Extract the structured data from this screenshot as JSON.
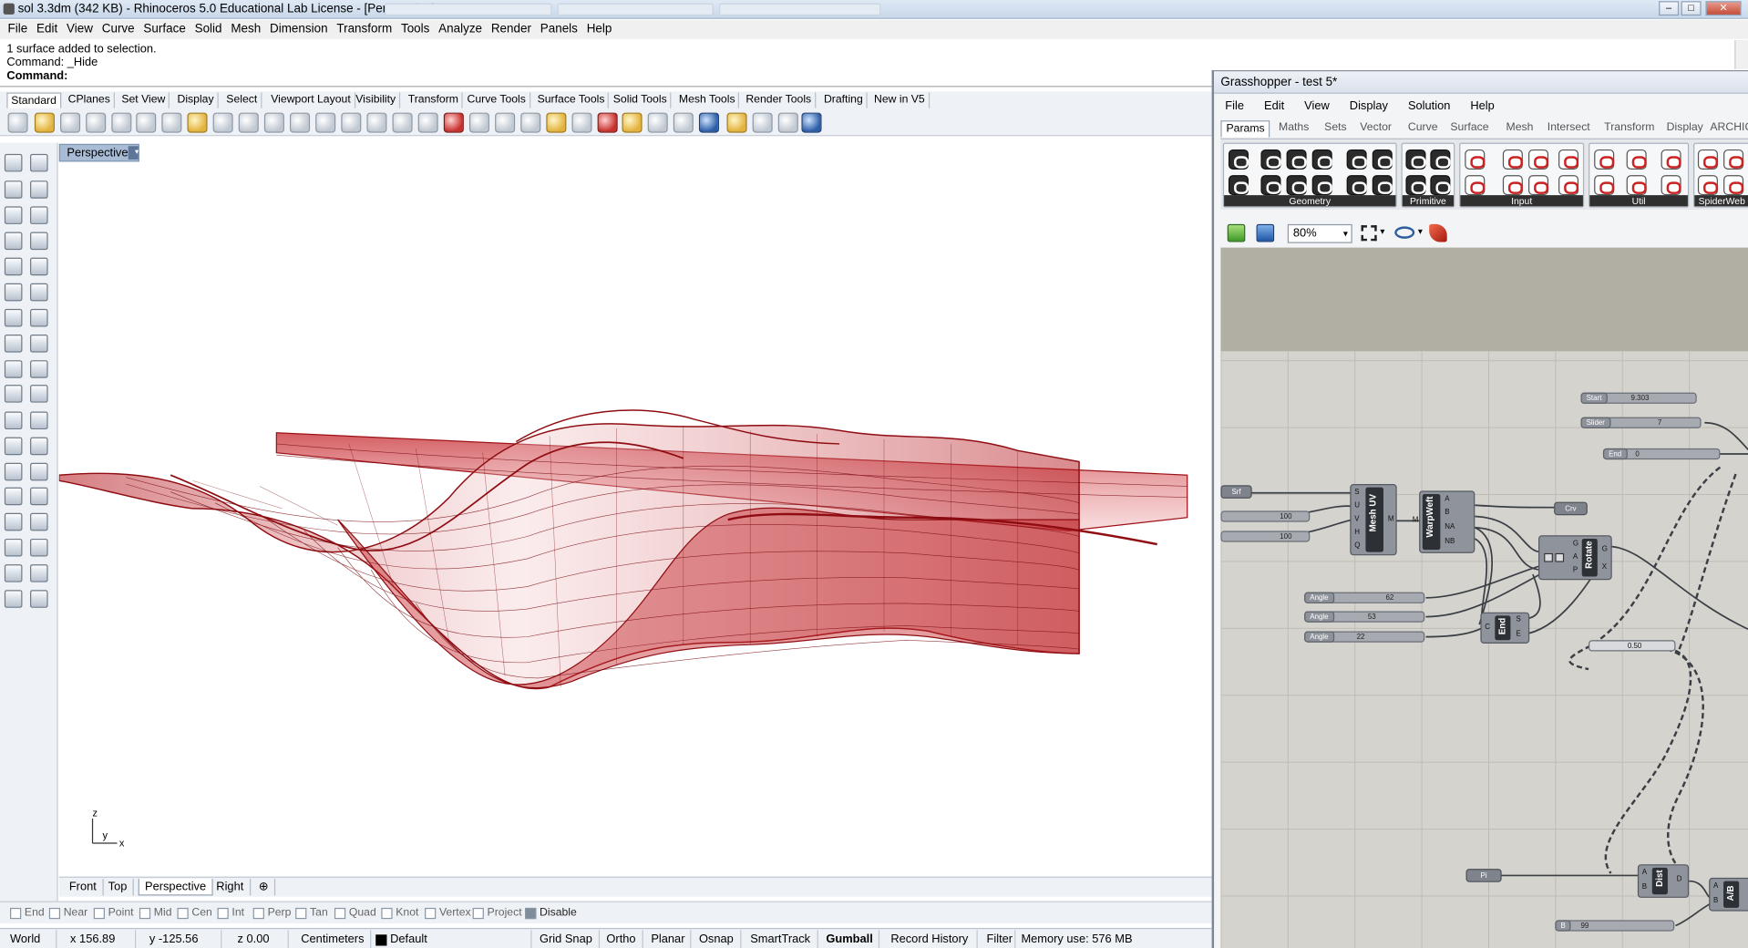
{
  "window": {
    "title": "sol 3.3dm (342 KB) - Rhinoceros 5.0 Educational Lab License - [Perspective]",
    "controls": [
      "–",
      "□",
      "✕"
    ]
  },
  "menu": [
    "File",
    "Edit",
    "View",
    "Curve",
    "Surface",
    "Solid",
    "Mesh",
    "Dimension",
    "Transform",
    "Tools",
    "Analyze",
    "Render",
    "Panels",
    "Help"
  ],
  "command": {
    "history_line1": "1 surface added to selection.",
    "history_line2": "Command: _Hide",
    "prompt": "Command:"
  },
  "toolbar_tabs": [
    "Standard",
    "CPlanes",
    "Set View",
    "Display",
    "Select",
    "Viewport Layout",
    "Visibility",
    "Transform",
    "Curve Tools",
    "Surface Tools",
    "Solid Tools",
    "Mesh Tools",
    "Render Tools",
    "Drafting",
    "New in V5"
  ],
  "viewport": {
    "name": "Perspective",
    "surface_color": "#b3141a",
    "axis": {
      "z": "z",
      "y": "y",
      "x": "x"
    }
  },
  "view_tabs": [
    "Front",
    "Top",
    "Perspective",
    "Right"
  ],
  "osnap": {
    "items": [
      {
        "label": "End",
        "on": false
      },
      {
        "label": "Near",
        "on": false
      },
      {
        "label": "Point",
        "on": false
      },
      {
        "label": "Mid",
        "on": false
      },
      {
        "label": "Cen",
        "on": false
      },
      {
        "label": "Int",
        "on": false
      },
      {
        "label": "Perp",
        "on": false
      },
      {
        "label": "Tan",
        "on": false
      },
      {
        "label": "Quad",
        "on": false
      },
      {
        "label": "Knot",
        "on": false
      },
      {
        "label": "Vertex",
        "on": false
      },
      {
        "label": "Project",
        "on": false
      },
      {
        "label": "Disable",
        "on": true
      }
    ]
  },
  "status": {
    "cplane": "World",
    "x": "x 156.89",
    "y": "y -125.56",
    "z": "z 0.00",
    "units": "Centimeters",
    "layer": "Default",
    "grid_snap": "Grid Snap",
    "ortho": "Ortho",
    "planar": "Planar",
    "osnap": "Osnap",
    "smarttrack": "SmartTrack",
    "gumball": "Gumball",
    "record_history": "Record History",
    "filter": "Filter",
    "memory": "Memory use: 576 MB"
  },
  "grasshopper": {
    "title": "Grasshopper - test 5*",
    "menu": [
      "File",
      "Edit",
      "View",
      "Display",
      "Solution",
      "Help"
    ],
    "tabs": [
      "Params",
      "Maths",
      "Sets",
      "Vector",
      "Curve",
      "Surface",
      "Mesh",
      "Intersect",
      "Transform",
      "Display",
      "ARCHICAD"
    ],
    "groups": [
      "Geometry",
      "Primitive",
      "Input",
      "Util",
      "SpiderWeb"
    ],
    "zoom": "80%",
    "nodes": {
      "start_label": "Start",
      "start_value": "9.303",
      "slider_label": "Slider",
      "slider_value": "7",
      "end_label": "End",
      "end_value": "0",
      "srf": "Srf",
      "uv1": "100",
      "uv2": "100",
      "meshuv": "Mesh UV",
      "meshuv_inputs": [
        "S",
        "U",
        "V",
        "H",
        "Q"
      ],
      "meshuv_output": "M",
      "warp_in": "M",
      "warpweft": "WarpWeft",
      "warp_outputs": [
        "A",
        "B",
        "NA",
        "NB"
      ],
      "crv": "Crv",
      "rotate": "Rotate",
      "rotate_inputs": [
        "G",
        "A",
        "P"
      ],
      "rotate_outputs": [
        "G",
        "X"
      ],
      "angle_label": "Angle",
      "angle1": "62",
      "angle2": "53",
      "angle3": "22",
      "end_node": "End",
      "end_ports": [
        "C",
        "S",
        "E"
      ],
      "factor": "0.50",
      "pi": "Pi",
      "dist": "Dist",
      "dist_ports": [
        "A",
        "B",
        "D"
      ],
      "ab": "A/B",
      "ab_ports": [
        "A",
        "B"
      ],
      "b_label": "B",
      "b_value": "99"
    }
  }
}
